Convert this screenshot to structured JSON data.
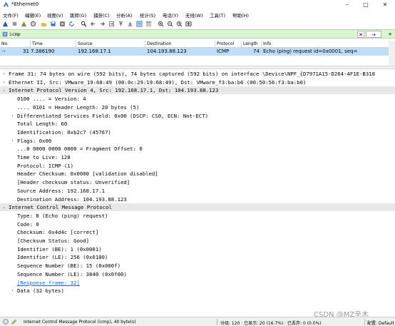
{
  "window": {
    "title": "*Ethernet0",
    "min_glyph": "–",
    "max_glyph": "□",
    "close_glyph": "✕"
  },
  "menu": [
    "文件(F)",
    "编辑(E)",
    "视图(V)",
    "跳转(G)",
    "捕获(C)",
    "分析(A)",
    "统计(S)",
    "电话(Y)",
    "无线(W)",
    "工具(T)",
    "帮助(H)"
  ],
  "toolbar_icons": [
    "shark-fin-start-icon",
    "stop-square-icon",
    "restart-shark-icon",
    "options-gear-icon",
    "open-folder-icon",
    "save-file-icon",
    "close-file-icon",
    "reload-icon",
    "find-packet-icon",
    "go-back-icon",
    "go-forward-icon",
    "go-to-packet-icon",
    "go-first-icon",
    "go-last-icon",
    "autoscroll-icon",
    "colorize-icon",
    "zoom-in-icon",
    "zoom-out-icon",
    "zoom-normal-icon",
    "resize-columns-icon"
  ],
  "filter": {
    "value": "icmp",
    "clear_glyph": "✕",
    "apply_glyph": "→",
    "expression_glyph": "+"
  },
  "columns": [
    "No.",
    "Time",
    "Source",
    "Destination",
    "Protocol",
    "Length",
    "Info"
  ],
  "packets": [
    {
      "no": "31",
      "time": "7.386190",
      "source": "192.168.17.1",
      "destination": "104.193.88.123",
      "protocol": "ICMP",
      "length": "74",
      "info": "Echo (ping) request  id=0x0001, seq="
    }
  ],
  "details": [
    {
      "text": "Frame 31: 74 bytes on wire (592 bits), 74 bytes captured (592 bits) on interface \\Device\\NPF_{D7971A15-D264-4F1E-B318",
      "indent": 0,
      "arrow": "›",
      "style": ""
    },
    {
      "text": "Ethernet II, Src: VMware_19:68:49 (00:0c:29:19:68:49), Dst: VMware_f3:ba:b6 (00:50:56:f3:ba:b6)",
      "indent": 0,
      "arrow": "›",
      "style": ""
    },
    {
      "text": "Internet Protocol Version 4, Src: 192.168.17.1, Dst: 104.193.88.123",
      "indent": 0,
      "arrow": "⌄",
      "style": "hl"
    },
    {
      "text": "0100 .... = Version: 4",
      "indent": 1,
      "arrow": "",
      "style": ""
    },
    {
      "text": ".... 0101 = Header Length: 20 bytes (5)",
      "indent": 1,
      "arrow": "",
      "style": ""
    },
    {
      "text": "Differentiated Services Field: 0x00 (DSCP: CS0, ECN: Not-ECT)",
      "indent": 1,
      "arrow": "›",
      "style": ""
    },
    {
      "text": "Total Length: 60",
      "indent": 1,
      "arrow": "",
      "style": ""
    },
    {
      "text": "Identification: 0xb2c7 (45767)",
      "indent": 1,
      "arrow": "",
      "style": ""
    },
    {
      "text": "Flags: 0x00",
      "indent": 1,
      "arrow": "›",
      "style": ""
    },
    {
      "text": "...0 0000 0000 0000 = Fragment Offset: 0",
      "indent": 1,
      "arrow": "",
      "style": ""
    },
    {
      "text": "Time to Live: 128",
      "indent": 1,
      "arrow": "",
      "style": ""
    },
    {
      "text": "Protocol: ICMP (1)",
      "indent": 1,
      "arrow": "",
      "style": ""
    },
    {
      "text": "Header Checksum: 0x0000 [validation disabled]",
      "indent": 1,
      "arrow": "",
      "style": ""
    },
    {
      "text": "[Header checksum status: Unverified]",
      "indent": 1,
      "arrow": "",
      "style": ""
    },
    {
      "text": "Source Address: 192.168.17.1",
      "indent": 1,
      "arrow": "",
      "style": ""
    },
    {
      "text": "Destination Address: 104.193.88.123",
      "indent": 1,
      "arrow": "",
      "style": ""
    },
    {
      "text": "Internet Control Message Protocol",
      "indent": 0,
      "arrow": "⌄",
      "style": "hl"
    },
    {
      "text": "Type: 8 (Echo (ping) request)",
      "indent": 1,
      "arrow": "",
      "style": ""
    },
    {
      "text": "Code: 0",
      "indent": 1,
      "arrow": "",
      "style": ""
    },
    {
      "text": "Checksum: 0x4d4c [correct]",
      "indent": 1,
      "arrow": "",
      "style": ""
    },
    {
      "text": "[Checksum Status: Good]",
      "indent": 1,
      "arrow": "",
      "style": ""
    },
    {
      "text": "Identifier (BE): 1 (0x0001)",
      "indent": 1,
      "arrow": "",
      "style": ""
    },
    {
      "text": "Identifier (LE): 256 (0x0100)",
      "indent": 1,
      "arrow": "",
      "style": ""
    },
    {
      "text": "Sequence Number (BE): 15 (0x000f)",
      "indent": 1,
      "arrow": "",
      "style": ""
    },
    {
      "text": "Sequence Number (LE): 3840 (0x0f00)",
      "indent": 1,
      "arrow": "",
      "style": ""
    },
    {
      "text": "[Response frame: 32]",
      "indent": 1,
      "arrow": "",
      "style": "link"
    },
    {
      "text": "Data (32 bytes)",
      "indent": 1,
      "arrow": "›",
      "style": ""
    }
  ],
  "status": {
    "field_info": "Internet Control Message Protocol (icmp), 40 byte(s)",
    "packets": "分组: 120 · 已显示: 20 (16.7%) · 已丢弃: 0 (0.0%)",
    "profile": "配置: Default"
  },
  "watermark": "CSDN @MZ辛木",
  "colors": {
    "filter_ok_bg": "#d7f8cf",
    "selected_row": "#c0ddf8",
    "link": "#1a5fcf",
    "shark_blue": "#1d5ba8"
  }
}
